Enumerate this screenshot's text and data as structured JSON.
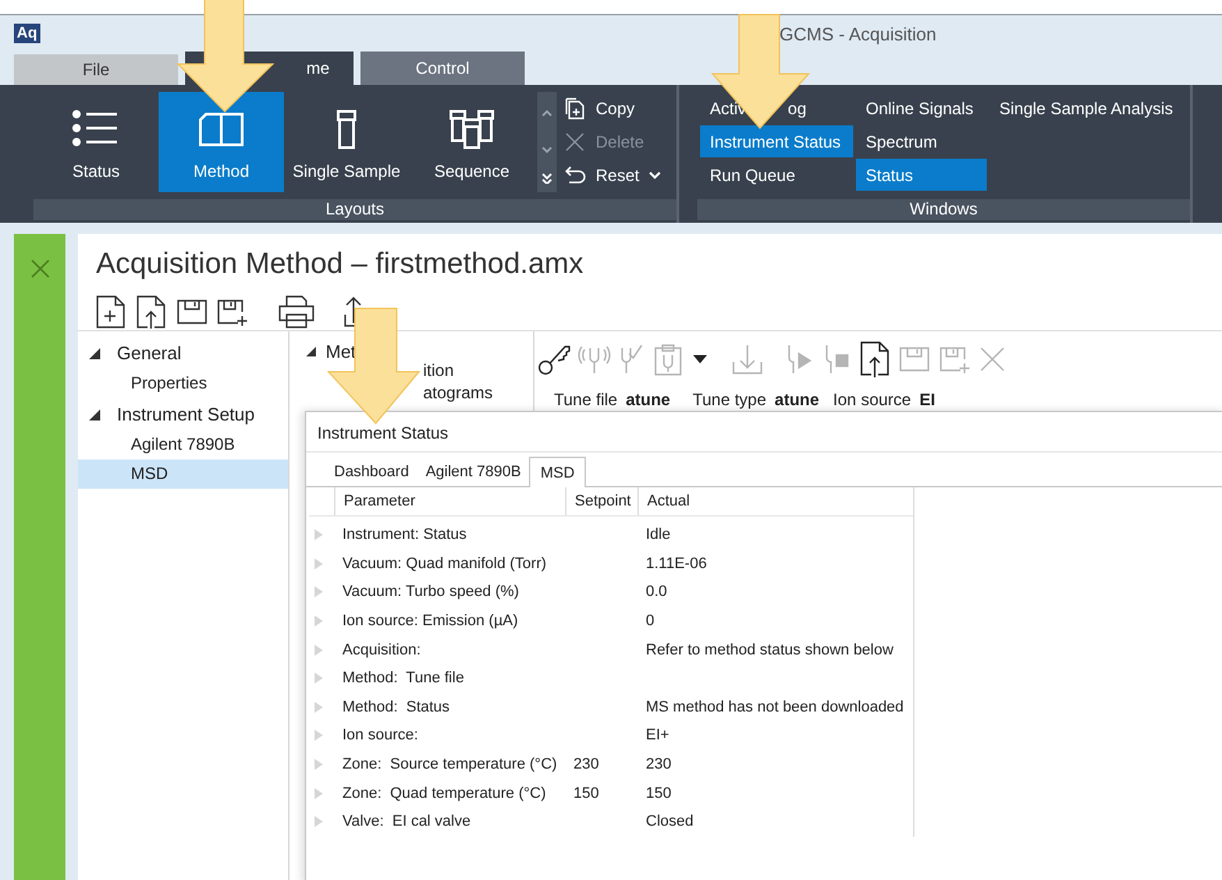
{
  "window": {
    "logo": "Aq",
    "title": "GCMS - Acquisition"
  },
  "ribbon_tabs": [
    {
      "label": "File",
      "kind": "file",
      "selected": false
    },
    {
      "label": "me",
      "kind": "home",
      "selected": true
    },
    {
      "label": "Control",
      "kind": "control",
      "selected": false
    }
  ],
  "layouts": {
    "label": "Layouts",
    "buttons": [
      {
        "label": "Status",
        "kind": "list",
        "selected": false
      },
      {
        "label": "Method",
        "kind": "book",
        "selected": true
      },
      {
        "label": "Single Sample",
        "kind": "vial",
        "selected": false
      },
      {
        "label": "Sequence",
        "kind": "vials",
        "selected": false
      }
    ],
    "actions": [
      {
        "label": "Copy",
        "kind": "copy",
        "disabled": false
      },
      {
        "label": "Delete",
        "kind": "delete",
        "disabled": true
      },
      {
        "label": "Reset",
        "kind": "reset",
        "disabled": false
      }
    ]
  },
  "windows": {
    "label": "Windows",
    "columns": [
      {
        "items": [
          {
            "label": "Activ",
            "label_end": "og",
            "selected": false
          },
          {
            "label": "Instrument Status",
            "selected": true
          },
          {
            "label": "Run Queue",
            "selected": false
          }
        ]
      },
      {
        "items": [
          {
            "label": "Online Signals",
            "selected": false
          },
          {
            "label": "Spectrum",
            "selected": false
          },
          {
            "label": "Status",
            "selected": true
          }
        ]
      },
      {
        "items": [
          {
            "label": "Single Sample Analysis",
            "selected": false
          }
        ]
      }
    ]
  },
  "document": {
    "title": "Acquisition Method – firstmethod.amx"
  },
  "tree": [
    {
      "label": "General",
      "expanded": true,
      "selected": false,
      "children": [
        {
          "label": "Properties",
          "selected": false
        }
      ]
    },
    {
      "label": "Instrument Setup",
      "expanded": true,
      "selected": false,
      "children": [
        {
          "label": "Agilent 7890B",
          "selected": false
        },
        {
          "label": "MSD",
          "selected": true
        }
      ]
    }
  ],
  "method_tree": {
    "label": "Met",
    "expanded": true,
    "children": [
      {
        "label": "ition"
      },
      {
        "label": "atograms"
      }
    ]
  },
  "tools": [
    {
      "kind": "key",
      "disabled": false
    },
    {
      "kind": "fork",
      "disabled": true
    },
    {
      "kind": "forkcheck",
      "disabled": true
    },
    {
      "kind": "clipboard",
      "disabled": true
    },
    {
      "kind": "caret",
      "disabled": false
    },
    {
      "kind": "download",
      "disabled": true
    },
    {
      "kind": "play",
      "disabled": true
    },
    {
      "kind": "stop",
      "disabled": true
    },
    {
      "kind": "upload",
      "disabled": false
    },
    {
      "kind": "save",
      "disabled": true
    },
    {
      "kind": "saveplus",
      "disabled": true
    },
    {
      "kind": "close",
      "disabled": true
    }
  ],
  "tune_info": [
    {
      "label": "Tune file",
      "value": "atune"
    },
    {
      "label": "Tune type",
      "value": "atune"
    },
    {
      "label": "Ion source",
      "value": "EI"
    }
  ],
  "status_window": {
    "title": "Instrument Status",
    "tabs": [
      {
        "label": "Dashboard",
        "selected": false
      },
      {
        "label": "Agilent 7890B",
        "selected": false
      },
      {
        "label": "MSD",
        "selected": true
      }
    ],
    "columns": [
      "Parameter",
      "Setpoint",
      "Actual"
    ],
    "rows": [
      {
        "parameter": "Instrument: Status",
        "actual": "Idle",
        "expanded": false
      },
      {
        "parameter": "Vacuum: Quad manifold (Torr)",
        "actual": "1.11E-06",
        "expanded": false
      },
      {
        "parameter": "Vacuum: Turbo speed (%)",
        "actual": "0.0",
        "expanded": false
      },
      {
        "parameter": "Ion source: Emission (µA)",
        "actual": "0",
        "expanded": false
      },
      {
        "parameter": "Acquisition:",
        "actual": "Refer to method status shown below",
        "expanded": false
      },
      {
        "parameter": "Method:  Tune file",
        "expanded": false
      },
      {
        "parameter": "Method:  Status",
        "actual": "MS method has not been downloaded",
        "expanded": false
      },
      {
        "parameter": "Ion source:",
        "actual": "EI+",
        "expanded": false
      },
      {
        "parameter": "Zone:  Source temperature (°C)",
        "setpoint": "230",
        "actual": "230",
        "expanded": false
      },
      {
        "parameter": "Zone:  Quad temperature (°C)",
        "setpoint": "150",
        "actual": "150",
        "expanded": false
      },
      {
        "parameter": "Valve:  EI cal valve",
        "actual": "Closed",
        "expanded": false
      }
    ]
  }
}
